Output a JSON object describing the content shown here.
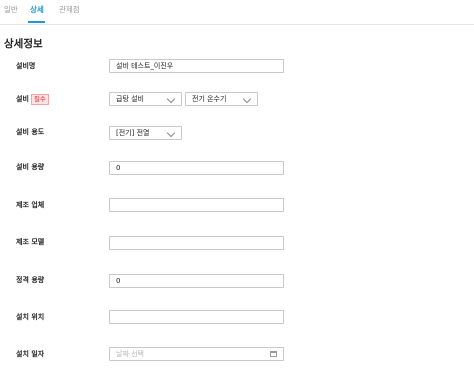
{
  "tabs": [
    {
      "label": "일반",
      "active": false
    },
    {
      "label": "상세",
      "active": true
    },
    {
      "label": "관제점",
      "active": false
    }
  ],
  "section": {
    "title": "상세정보"
  },
  "fields": {
    "name": {
      "label": "설비명",
      "value": "설비 테스트_이진우"
    },
    "equipment": {
      "label": "설비",
      "badge": "필수",
      "select1": "급탕 설비",
      "select2": "전기 온수기"
    },
    "usage": {
      "label": "설비 용도",
      "value": "[전기] 전열"
    },
    "capacity": {
      "label": "설비 용량",
      "value": "0"
    },
    "maker": {
      "label": "제조 업체",
      "value": ""
    },
    "model": {
      "label": "제조 모델",
      "value": ""
    },
    "rated": {
      "label": "정격 용량",
      "value": "0"
    },
    "location": {
      "label": "설치 위치",
      "value": ""
    },
    "install_date": {
      "label": "설치 일자",
      "placeholder": "날짜 선택"
    }
  },
  "colors": {
    "accent": "#2196d9",
    "badge_red": "#e03030"
  }
}
